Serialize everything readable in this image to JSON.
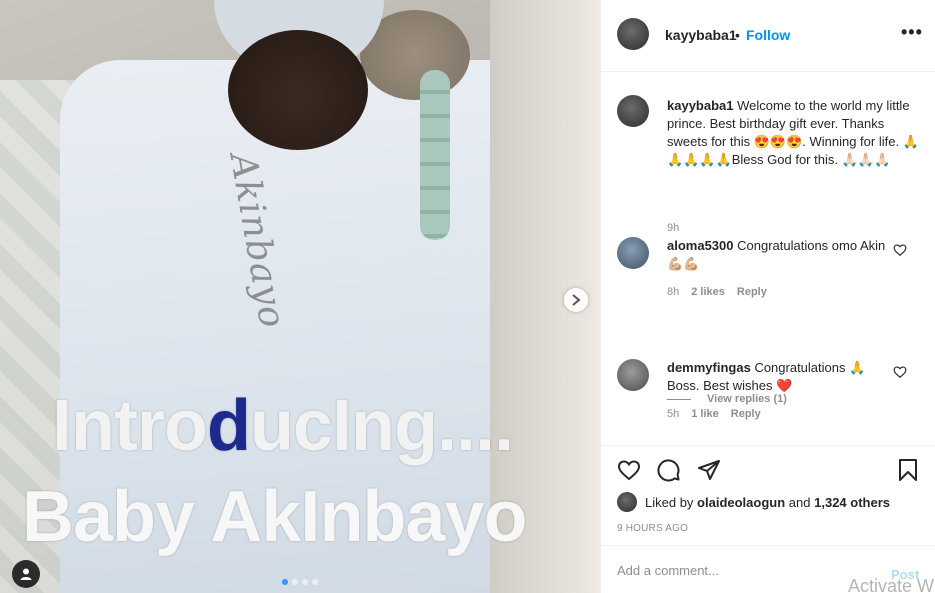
{
  "media": {
    "overlay_line1_a": "Intro",
    "overlay_line1_b": "d",
    "overlay_line1_c": "ucIng....",
    "overlay_line2": "Baby AkInbayo",
    "blanket_name": "Akinbayo",
    "carousel_count": 4,
    "carousel_active_index": 0
  },
  "header": {
    "username": "kayybaba1",
    "separator": "•",
    "follow_label": "Follow",
    "more_label": "•••"
  },
  "caption": {
    "username": "kayybaba1",
    "text": "Welcome to the world my little prince. Best birthday gift ever. Thanks sweets for this 😍😍😍. Winning for life. 🙏🙏🙏🙏🙏Bless God for this. 🙏🏻🙏🏻🙏🏻",
    "time": "9h"
  },
  "comments": [
    {
      "username": "aloma5300",
      "text": "Congratulations omo Akin 💪🏼💪🏼",
      "time": "8h",
      "likes": "2 likes",
      "reply_label": "Reply",
      "view_replies": "View replies (1)"
    },
    {
      "username": "demmyfingas",
      "text": "Congratulations 🙏 Boss. Best wishes ❤️",
      "time": "5h",
      "likes": "1 like",
      "reply_label": "Reply"
    }
  ],
  "likes": {
    "prefix": "Liked by",
    "user": "olaideolaogun",
    "and": "and",
    "others": "1,324 others"
  },
  "timestamp": "9 HOURS AGO",
  "add_comment": {
    "placeholder": "Add a comment...",
    "post_label": "Post"
  },
  "os_watermark": "Activate W",
  "colors": {
    "link_blue": "#0095f6",
    "post_disabled": "#b3dbff",
    "heart_red": "#c71f1f",
    "muted_text": "#8e8e8e",
    "overlay_blue": "#1b2a8c"
  }
}
